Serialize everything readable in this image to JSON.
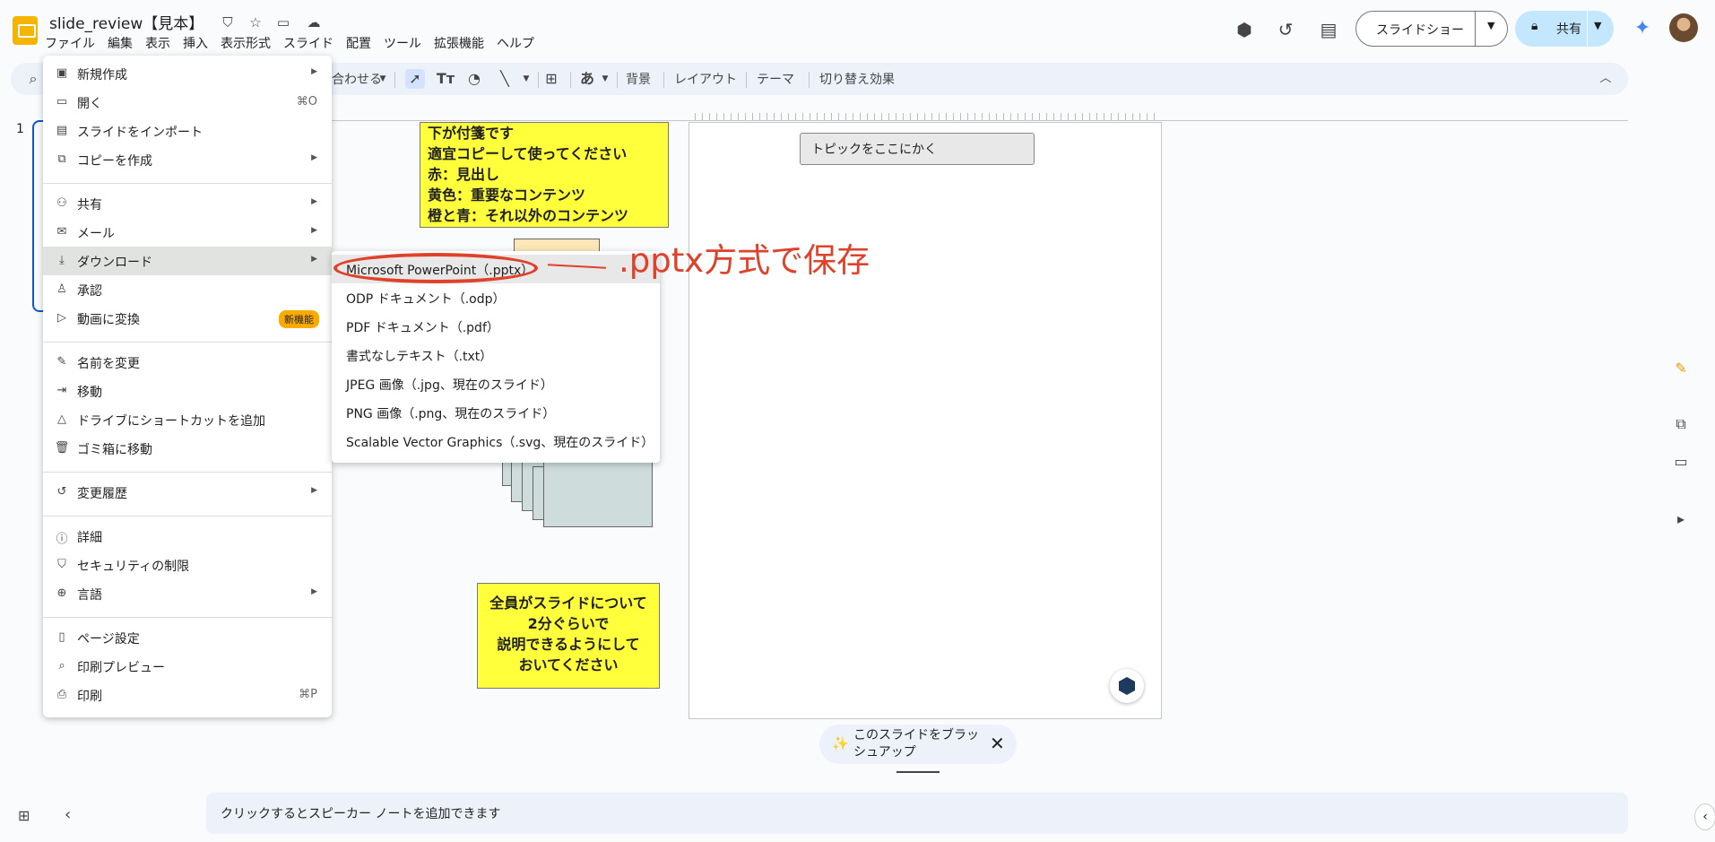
{
  "header": {
    "doc_title": "slide_review【見本】",
    "menus": [
      "ファイル",
      "編集",
      "表示",
      "挿入",
      "表示形式",
      "スライド",
      "配置",
      "ツール",
      "拡張機能",
      "ヘルプ"
    ],
    "slideshow_label": "スライドショー",
    "share_label": "共有"
  },
  "toolbar": {
    "fit_label": "合わせる",
    "background": "背景",
    "layout": "レイアウト",
    "theme": "テーマ",
    "transition": "切り替え効果",
    "text_glyph": "あ"
  },
  "filmstrip": {
    "slide_number": "1"
  },
  "slide": {
    "topic_placeholder": "トピックをここにかく",
    "sticky_top": [
      "下が付箋です",
      "適宜コピーして使ってください",
      "赤：見出し",
      "黄色：重要なコンテンツ",
      "橙と青：それ以外のコンテンツ"
    ],
    "sticky_bottom": [
      "全員がスライドについて",
      "2分ぐらいで",
      "説明できるようにして",
      "おいてください"
    ]
  },
  "file_menu": {
    "items": [
      {
        "label": "新規作成",
        "icon": "new-slides-icon",
        "arrow": true
      },
      {
        "label": "開く",
        "icon": "folder-icon",
        "shortcut": "⌘O"
      },
      {
        "label": "スライドをインポート",
        "icon": "import-icon"
      },
      {
        "label": "コピーを作成",
        "icon": "copy-icon",
        "arrow": true
      },
      {
        "label": "共有",
        "icon": "person-add-icon",
        "arrow": true
      },
      {
        "label": "メール",
        "icon": "mail-icon",
        "arrow": true
      },
      {
        "label": "ダウンロード",
        "icon": "download-icon",
        "arrow": true,
        "active": true
      },
      {
        "label": "承認",
        "icon": "approval-icon"
      },
      {
        "label": "動画に変換",
        "icon": "video-icon",
        "badge": "新機能"
      },
      {
        "label": "名前を変更",
        "icon": "rename-icon"
      },
      {
        "label": "移動",
        "icon": "move-icon"
      },
      {
        "label": "ドライブにショートカットを追加",
        "icon": "drive-shortcut-icon"
      },
      {
        "label": "ゴミ箱に移動",
        "icon": "trash-icon"
      },
      {
        "label": "変更履歴",
        "icon": "history-icon",
        "arrow": true
      },
      {
        "label": "詳細",
        "icon": "info-icon"
      },
      {
        "label": "セキュリティの制限",
        "icon": "security-icon"
      },
      {
        "label": "言語",
        "icon": "globe-icon",
        "arrow": true
      },
      {
        "label": "ページ設定",
        "icon": "page-setup-icon"
      },
      {
        "label": "印刷プレビュー",
        "icon": "print-preview-icon"
      },
      {
        "label": "印刷",
        "icon": "print-icon",
        "shortcut": "⌘P"
      }
    ]
  },
  "download_menu": {
    "items": [
      "Microsoft PowerPoint（.pptx）",
      "ODP ドキュメント（.odp）",
      "PDF ドキュメント（.pdf）",
      "書式なしテキスト（.txt）",
      "JPEG 画像（.jpg、現在のスライド）",
      "PNG 画像（.png、現在のスライド）",
      "Scalable Vector Graphics（.svg、現在のスライド）"
    ]
  },
  "annotation": {
    "note": ".pptx方式で保存",
    "color": "#e0412b"
  },
  "bottom": {
    "polish_chip": "このスライドをブラッシュアップ",
    "speaker_notes_placeholder": "クリックするとスピーカー ノートを追加できます"
  },
  "colors": {
    "accent": "#0b57d0",
    "share_bg": "#c2e7ff",
    "sticky": "#ffff3b",
    "badge": "#f9ab00"
  }
}
